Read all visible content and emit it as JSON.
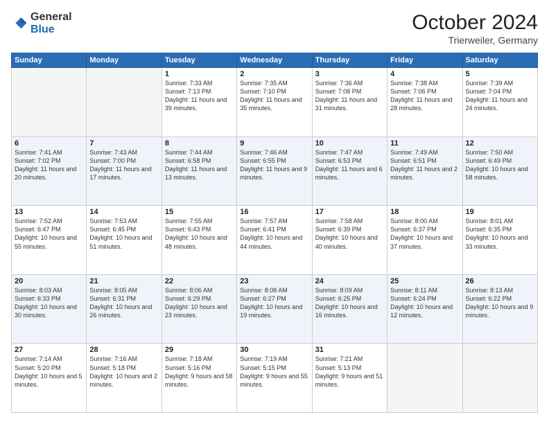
{
  "logo": {
    "general": "General",
    "blue": "Blue"
  },
  "title": {
    "month": "October 2024",
    "location": "Trierweiler, Germany"
  },
  "headers": [
    "Sunday",
    "Monday",
    "Tuesday",
    "Wednesday",
    "Thursday",
    "Friday",
    "Saturday"
  ],
  "weeks": [
    [
      {
        "day": null,
        "sunrise": null,
        "sunset": null,
        "daylight": null
      },
      {
        "day": null,
        "sunrise": null,
        "sunset": null,
        "daylight": null
      },
      {
        "day": "1",
        "sunrise": "Sunrise: 7:33 AM",
        "sunset": "Sunset: 7:13 PM",
        "daylight": "Daylight: 11 hours and 39 minutes."
      },
      {
        "day": "2",
        "sunrise": "Sunrise: 7:35 AM",
        "sunset": "Sunset: 7:10 PM",
        "daylight": "Daylight: 11 hours and 35 minutes."
      },
      {
        "day": "3",
        "sunrise": "Sunrise: 7:36 AM",
        "sunset": "Sunset: 7:08 PM",
        "daylight": "Daylight: 11 hours and 31 minutes."
      },
      {
        "day": "4",
        "sunrise": "Sunrise: 7:38 AM",
        "sunset": "Sunset: 7:06 PM",
        "daylight": "Daylight: 11 hours and 28 minutes."
      },
      {
        "day": "5",
        "sunrise": "Sunrise: 7:39 AM",
        "sunset": "Sunset: 7:04 PM",
        "daylight": "Daylight: 11 hours and 24 minutes."
      }
    ],
    [
      {
        "day": "6",
        "sunrise": "Sunrise: 7:41 AM",
        "sunset": "Sunset: 7:02 PM",
        "daylight": "Daylight: 11 hours and 20 minutes."
      },
      {
        "day": "7",
        "sunrise": "Sunrise: 7:43 AM",
        "sunset": "Sunset: 7:00 PM",
        "daylight": "Daylight: 11 hours and 17 minutes."
      },
      {
        "day": "8",
        "sunrise": "Sunrise: 7:44 AM",
        "sunset": "Sunset: 6:58 PM",
        "daylight": "Daylight: 11 hours and 13 minutes."
      },
      {
        "day": "9",
        "sunrise": "Sunrise: 7:46 AM",
        "sunset": "Sunset: 6:55 PM",
        "daylight": "Daylight: 11 hours and 9 minutes."
      },
      {
        "day": "10",
        "sunrise": "Sunrise: 7:47 AM",
        "sunset": "Sunset: 6:53 PM",
        "daylight": "Daylight: 11 hours and 6 minutes."
      },
      {
        "day": "11",
        "sunrise": "Sunrise: 7:49 AM",
        "sunset": "Sunset: 6:51 PM",
        "daylight": "Daylight: 11 hours and 2 minutes."
      },
      {
        "day": "12",
        "sunrise": "Sunrise: 7:50 AM",
        "sunset": "Sunset: 6:49 PM",
        "daylight": "Daylight: 10 hours and 58 minutes."
      }
    ],
    [
      {
        "day": "13",
        "sunrise": "Sunrise: 7:52 AM",
        "sunset": "Sunset: 6:47 PM",
        "daylight": "Daylight: 10 hours and 55 minutes."
      },
      {
        "day": "14",
        "sunrise": "Sunrise: 7:53 AM",
        "sunset": "Sunset: 6:45 PM",
        "daylight": "Daylight: 10 hours and 51 minutes."
      },
      {
        "day": "15",
        "sunrise": "Sunrise: 7:55 AM",
        "sunset": "Sunset: 6:43 PM",
        "daylight": "Daylight: 10 hours and 48 minutes."
      },
      {
        "day": "16",
        "sunrise": "Sunrise: 7:57 AM",
        "sunset": "Sunset: 6:41 PM",
        "daylight": "Daylight: 10 hours and 44 minutes."
      },
      {
        "day": "17",
        "sunrise": "Sunrise: 7:58 AM",
        "sunset": "Sunset: 6:39 PM",
        "daylight": "Daylight: 10 hours and 40 minutes."
      },
      {
        "day": "18",
        "sunrise": "Sunrise: 8:00 AM",
        "sunset": "Sunset: 6:37 PM",
        "daylight": "Daylight: 10 hours and 37 minutes."
      },
      {
        "day": "19",
        "sunrise": "Sunrise: 8:01 AM",
        "sunset": "Sunset: 6:35 PM",
        "daylight": "Daylight: 10 hours and 33 minutes."
      }
    ],
    [
      {
        "day": "20",
        "sunrise": "Sunrise: 8:03 AM",
        "sunset": "Sunset: 6:33 PM",
        "daylight": "Daylight: 10 hours and 30 minutes."
      },
      {
        "day": "21",
        "sunrise": "Sunrise: 8:05 AM",
        "sunset": "Sunset: 6:31 PM",
        "daylight": "Daylight: 10 hours and 26 minutes."
      },
      {
        "day": "22",
        "sunrise": "Sunrise: 8:06 AM",
        "sunset": "Sunset: 6:29 PM",
        "daylight": "Daylight: 10 hours and 23 minutes."
      },
      {
        "day": "23",
        "sunrise": "Sunrise: 8:08 AM",
        "sunset": "Sunset: 6:27 PM",
        "daylight": "Daylight: 10 hours and 19 minutes."
      },
      {
        "day": "24",
        "sunrise": "Sunrise: 8:09 AM",
        "sunset": "Sunset: 6:25 PM",
        "daylight": "Daylight: 10 hours and 16 minutes."
      },
      {
        "day": "25",
        "sunrise": "Sunrise: 8:11 AM",
        "sunset": "Sunset: 6:24 PM",
        "daylight": "Daylight: 10 hours and 12 minutes."
      },
      {
        "day": "26",
        "sunrise": "Sunrise: 8:13 AM",
        "sunset": "Sunset: 6:22 PM",
        "daylight": "Daylight: 10 hours and 9 minutes."
      }
    ],
    [
      {
        "day": "27",
        "sunrise": "Sunrise: 7:14 AM",
        "sunset": "Sunset: 5:20 PM",
        "daylight": "Daylight: 10 hours and 5 minutes."
      },
      {
        "day": "28",
        "sunrise": "Sunrise: 7:16 AM",
        "sunset": "Sunset: 5:18 PM",
        "daylight": "Daylight: 10 hours and 2 minutes."
      },
      {
        "day": "29",
        "sunrise": "Sunrise: 7:18 AM",
        "sunset": "Sunset: 5:16 PM",
        "daylight": "Daylight: 9 hours and 58 minutes."
      },
      {
        "day": "30",
        "sunrise": "Sunrise: 7:19 AM",
        "sunset": "Sunset: 5:15 PM",
        "daylight": "Daylight: 9 hours and 55 minutes."
      },
      {
        "day": "31",
        "sunrise": "Sunrise: 7:21 AM",
        "sunset": "Sunset: 5:13 PM",
        "daylight": "Daylight: 9 hours and 51 minutes."
      },
      {
        "day": null,
        "sunrise": null,
        "sunset": null,
        "daylight": null
      },
      {
        "day": null,
        "sunrise": null,
        "sunset": null,
        "daylight": null
      }
    ]
  ]
}
